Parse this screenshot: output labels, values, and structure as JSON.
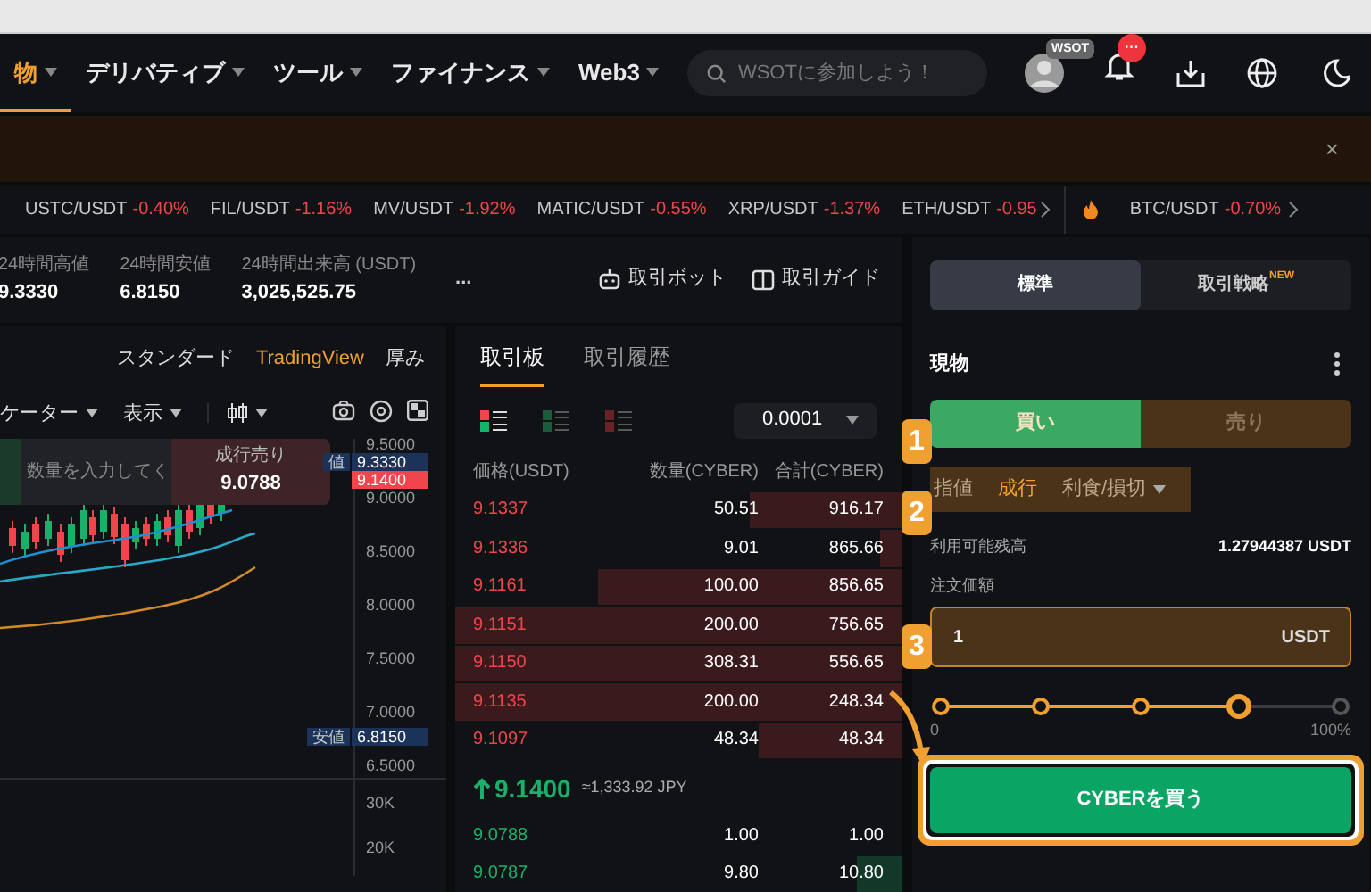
{
  "nav": {
    "items": [
      {
        "label": "物",
        "selected": true,
        "caret": true
      },
      {
        "label": "デリバティブ",
        "selected": false,
        "caret": true
      },
      {
        "label": "ツール",
        "selected": false,
        "caret": true
      },
      {
        "label": "ファイナンス",
        "selected": false,
        "caret": true
      },
      {
        "label": "Web3",
        "selected": false,
        "caret": true
      }
    ],
    "search": {
      "placeholder": "WSOTに参加しよう！"
    },
    "avatar_badge": "WSOT",
    "notification_badge": "···"
  },
  "banner": {
    "close": "×"
  },
  "ticker": [
    {
      "pair": "USTC/USDT",
      "change": "-0.40%"
    },
    {
      "pair": "FIL/USDT",
      "change": "-1.16%"
    },
    {
      "pair": "MV/USDT",
      "change": "-1.92%"
    },
    {
      "pair": "MATIC/USDT",
      "change": "-0.55%"
    },
    {
      "pair": "XRP/USDT",
      "change": "-1.37%"
    },
    {
      "pair": "ETH/USDT",
      "change": "-0.95"
    }
  ],
  "ticker_hot": [
    {
      "pair": "BTC/USDT",
      "change": "-0.70%"
    }
  ],
  "stats": [
    {
      "label": "24時間高値",
      "value": "9.3330"
    },
    {
      "label": "24時間安値",
      "value": "6.8150"
    },
    {
      "label": "24時間出来高 (USDT)",
      "value": "3,025,525.75"
    }
  ],
  "stats_more": "...",
  "tools": [
    {
      "label": "取引ボット",
      "kind": "bot"
    },
    {
      "label": "取引ガイド",
      "kind": "guide"
    }
  ],
  "chart": {
    "tabs": [
      {
        "label": "スタンダード",
        "selected": false
      },
      {
        "label": "TradingView",
        "selected": true
      },
      {
        "label": "厚み",
        "selected": false
      }
    ],
    "toolbar": [
      "ケーター",
      "表示"
    ],
    "quick_order": {
      "placeholder": "数量を入力してく",
      "sell_label": "成行売り",
      "sell_price": "9.0788"
    },
    "price_axis": [
      "9.5000",
      "9.0000",
      "8.5000",
      "8.0000",
      "7.5000",
      "7.0000",
      "6.5000"
    ],
    "volume_axis": [
      "30K",
      "20K"
    ],
    "tags": [
      {
        "label": "値",
        "value": "9.3330",
        "kind": "high"
      },
      {
        "value": "9.1400",
        "kind": "last"
      },
      {
        "label": "安値",
        "value": "6.8150",
        "kind": "low"
      }
    ]
  },
  "orderbook": {
    "tabs": [
      {
        "label": "取引板",
        "selected": true
      },
      {
        "label": "取引履歴",
        "selected": false
      }
    ],
    "views": [
      {
        "kind": "both",
        "selected": true
      },
      {
        "kind": "bids",
        "selected": false
      },
      {
        "kind": "asks",
        "selected": false
      }
    ],
    "precision": "0.0001",
    "columns": [
      "価格(USDT)",
      "数量(CYBER)",
      "合計(CYBER)"
    ],
    "asks": [
      {
        "price": "9.1337",
        "amount": "50.51",
        "total": "916.17",
        "level": 0.34
      },
      {
        "price": "9.1336",
        "amount": "9.01",
        "total": "865.66",
        "level": 0.05
      },
      {
        "price": "9.1161",
        "amount": "100.00",
        "total": "856.65",
        "level": 0.68
      },
      {
        "price": "9.1151",
        "amount": "200.00",
        "total": "756.65",
        "level": 1
      },
      {
        "price": "9.1150",
        "amount": "308.31",
        "total": "556.65",
        "level": 1
      },
      {
        "price": "9.1135",
        "amount": "200.00",
        "total": "248.34",
        "level": 1
      },
      {
        "price": "9.1097",
        "amount": "48.34",
        "total": "48.34",
        "level": 0.32
      }
    ],
    "last_price": "9.1400",
    "last_price_jpy": "≈1,333.92 JPY",
    "bids": [
      {
        "price": "9.0788",
        "amount": "1.00",
        "total": "1.00"
      },
      {
        "price": "9.0787",
        "amount": "9.80",
        "total": "10.80",
        "level": 0.1
      }
    ]
  },
  "trade": {
    "modes": [
      {
        "label": "標準",
        "selected": true
      },
      {
        "label": "取引戦略",
        "selected": false,
        "badge": "NEW"
      }
    ],
    "title": "現物",
    "sides": [
      {
        "label": "買い",
        "selected": true
      },
      {
        "label": "売り",
        "selected": false
      }
    ],
    "order_types": [
      {
        "label": "指値",
        "selected": false,
        "caret": false
      },
      {
        "label": "成行",
        "selected": true,
        "caret": false
      },
      {
        "label": "利食/損切",
        "selected": false,
        "caret": true
      }
    ],
    "available_label": "利用可能残高",
    "available_value": "1.27944387 USDT",
    "amount_label": "注文価額",
    "amount_value": "1",
    "amount_unit": "USDT",
    "slider": {
      "level": 0.75,
      "min_label": "0",
      "max_label": "100%"
    },
    "submit": "CYBERを買う"
  },
  "callouts": [
    "1",
    "2",
    "3"
  ]
}
